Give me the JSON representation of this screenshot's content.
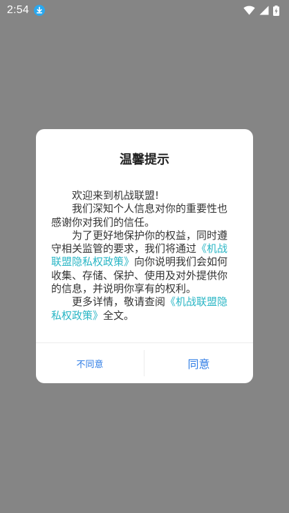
{
  "status_bar": {
    "time": "2:54",
    "icons": [
      "download-notification-icon",
      "wifi-icon",
      "cellular-signal-icon",
      "battery-charging-icon"
    ]
  },
  "dialog": {
    "title": "温馨提示",
    "greeting": "欢迎来到机战联盟!",
    "p2": "我们深知个人信息对你的重要性也感谢你对我们的信任。",
    "p3_before": "为了更好地保护你的权益，同时遵守相关监管的要求，我们将通过",
    "p3_link": "《机战联盟隐私权政策》",
    "p3_after": "向你说明我们会如何收集、存储、保护、使用及对外提供你的信息，并说明你享有的权利。",
    "p4_before": "更多详情，敬请查阅",
    "p4_link": "《机战联盟隐私权政策》",
    "p4_after": "全文。",
    "disagree_label": "不同意",
    "agree_label": "同意"
  },
  "colors": {
    "scrim": "#858585",
    "link": "#29b6c5",
    "button_text": "#2c7be5",
    "download_badge": "#29a8f0"
  }
}
